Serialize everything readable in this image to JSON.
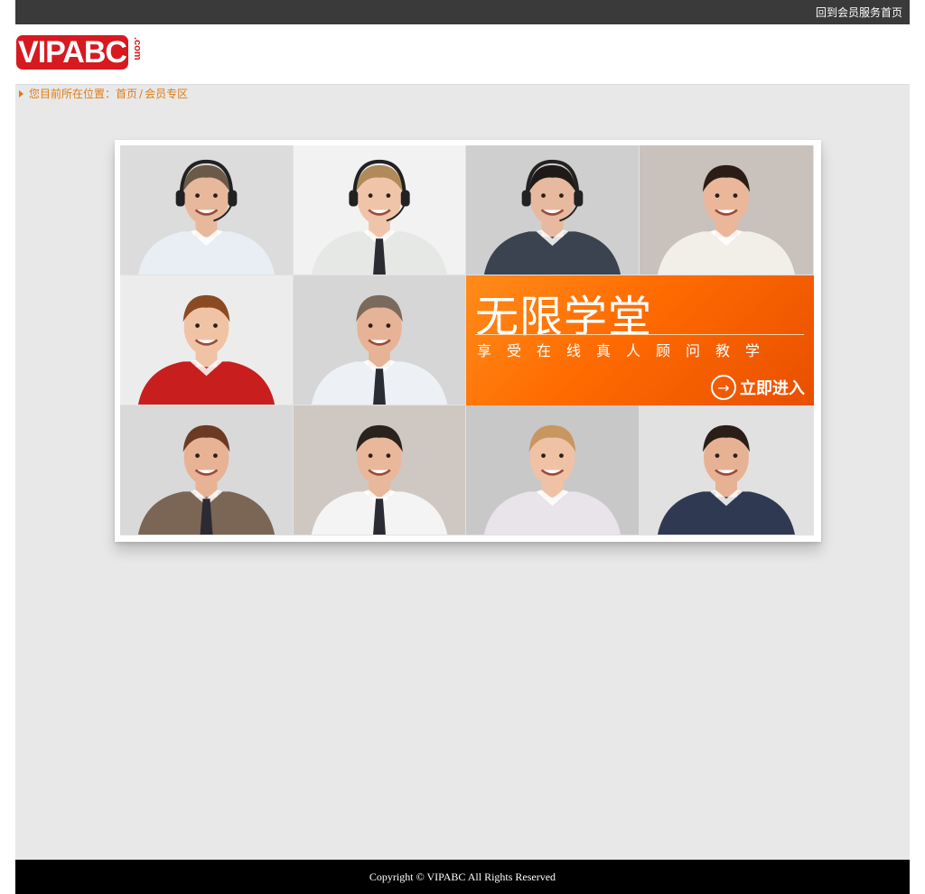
{
  "topbar": {
    "link_label": "回到会员服务首页"
  },
  "brand": {
    "logo_text": "VIPABC",
    "logo_suffix": ".com",
    "color": "#d71920"
  },
  "breadcrumb": {
    "prefix": "您目前所在位置：",
    "home": "首页",
    "separator": "/",
    "current": "会员专区",
    "color": "#e07b13"
  },
  "promo": {
    "title": "无限学堂",
    "subtitle": "享受在线真人顾问教学",
    "enter_label": "立即进入",
    "arrow_icon": "→"
  },
  "tiles": [
    {
      "shirt": "#e9eef4",
      "bg": "#dcdcdc",
      "hair": "#6b5a48",
      "skin": "#e8b89c",
      "headset": true,
      "tie": false
    },
    {
      "shirt": "#e6e8e6",
      "bg": "#f2f2f2",
      "hair": "#b08a58",
      "skin": "#efc4a8",
      "headset": true,
      "tie": true
    },
    {
      "shirt": "#3b4250",
      "bg": "#cfcfcf",
      "hair": "#1f1a17",
      "skin": "#e7b99e",
      "headset": true,
      "tie": false
    },
    {
      "shirt": "#f2eee8",
      "bg": "#c9c1bb",
      "hair": "#2b1d15",
      "skin": "#eab79b",
      "headset": false,
      "tie": false
    },
    {
      "shirt": "#c81e1e",
      "bg": "#ececec",
      "hair": "#8a4a22",
      "skin": "#f0c3a5",
      "headset": false,
      "tie": false
    },
    {
      "shirt": "#edf1f5",
      "bg": "#d6d6d6",
      "hair": "#7a6a5c",
      "skin": "#e6b397",
      "headset": false,
      "tie": true
    },
    {
      "shirt": "#7b6656",
      "bg": "#d9d9d9",
      "hair": "#6a3a22",
      "skin": "#e8b295",
      "headset": false,
      "tie": true
    },
    {
      "shirt": "#f4f4f4",
      "bg": "#cfc8c2",
      "hair": "#2a221c",
      "skin": "#e9b79a",
      "headset": false,
      "tie": true
    },
    {
      "shirt": "#e9e3ea",
      "bg": "#c8c8c8",
      "hair": "#c8965f",
      "skin": "#efc2a6",
      "headset": false,
      "tie": false
    },
    {
      "shirt": "#2f3a52",
      "bg": "#e1e1e1",
      "hair": "#2a1f18",
      "skin": "#e7b294",
      "headset": false,
      "tie": false
    }
  ],
  "footer": {
    "copyright": "Copyright © VIPABC All Rights Reserved"
  }
}
